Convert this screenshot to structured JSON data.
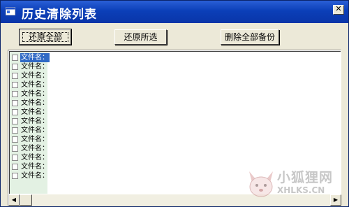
{
  "window": {
    "title": "历史清除列表",
    "close_glyph": "✕",
    "app_icon": "app-icon"
  },
  "toolbar": {
    "restore_all_label": "还原全部",
    "restore_selected_label": "还原所选",
    "delete_all_backups_label": "删除全部备份"
  },
  "file_list": {
    "items": [
      {
        "label": "文件名：",
        "checked": false,
        "selected": true
      },
      {
        "label": "文件名：",
        "checked": false,
        "selected": false
      },
      {
        "label": "文件名：",
        "checked": false,
        "selected": false
      },
      {
        "label": "文件名：",
        "checked": false,
        "selected": false
      },
      {
        "label": "文件名：",
        "checked": false,
        "selected": false
      },
      {
        "label": "文件名：",
        "checked": false,
        "selected": false
      },
      {
        "label": "文件名：",
        "checked": false,
        "selected": false
      },
      {
        "label": "文件名：",
        "checked": false,
        "selected": false
      },
      {
        "label": "文件名：",
        "checked": false,
        "selected": false
      },
      {
        "label": "文件名：",
        "checked": false,
        "selected": false
      },
      {
        "label": "文件名：",
        "checked": false,
        "selected": false
      },
      {
        "label": "文件名：",
        "checked": false,
        "selected": false
      },
      {
        "label": "文件名：",
        "checked": false,
        "selected": false
      },
      {
        "label": "文件名：",
        "checked": false,
        "selected": false
      }
    ]
  },
  "scrollbar": {
    "left_arrow": "◀",
    "right_arrow": "▶"
  },
  "watermark": {
    "text_cn": "小狐狸网",
    "text_en": "XHLKS.CN"
  },
  "colors": {
    "titlebar": "#0b3fb8",
    "selection": "#316ac5",
    "list_column_bg": "#e3f1e3",
    "window_bg": "#ece9d8"
  }
}
